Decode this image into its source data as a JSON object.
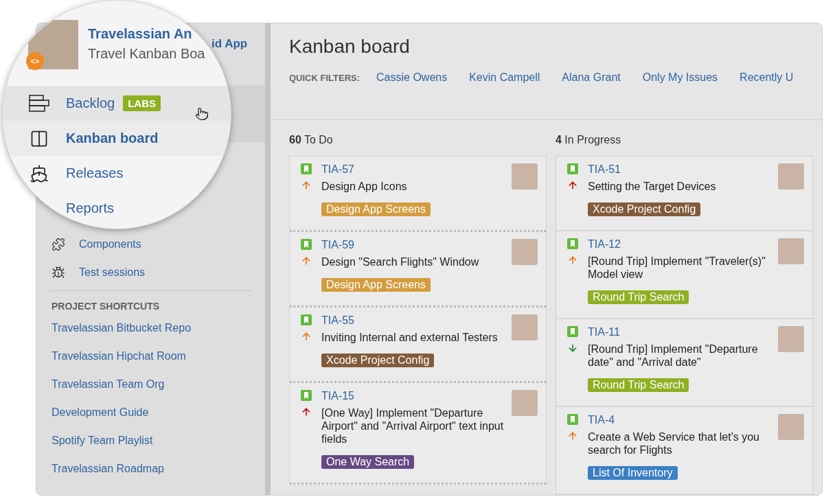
{
  "sidebar": {
    "project_title_tail": "id App",
    "items": [
      {
        "label": "Components"
      },
      {
        "label": "Test sessions"
      }
    ],
    "shortcuts_heading": "PROJECT SHORTCUTS",
    "shortcuts": [
      "Travelassian Bitbucket Repo",
      "Travelassian Hipchat Room",
      "Travelassian Team Org",
      "Development Guide",
      "Spotify Team Playlist",
      "Travelassian Roadmap"
    ]
  },
  "magnifier": {
    "project_title": "Travelassian An",
    "board_name": "Travel Kanban Boa",
    "badge": "<>",
    "items": [
      {
        "label": "Backlog",
        "badge": "LABS",
        "selected": false,
        "hovered": true
      },
      {
        "label": "Kanban board",
        "selected": true,
        "hovered": false
      },
      {
        "label": "Releases",
        "selected": false,
        "hovered": false
      },
      {
        "label": "Reports",
        "selected": false,
        "hovered": false
      }
    ]
  },
  "board": {
    "title": "Kanban board",
    "quick_filters_label": "QUICK FILTERS:",
    "quick_filters": [
      "Cassie Owens",
      "Kevin Campell",
      "Alana Grant",
      "Only My Issues",
      "Recently U"
    ],
    "columns": [
      {
        "count": "60",
        "name": "To Do",
        "ranked": true,
        "cards": [
          {
            "key": "TIA-57",
            "kind": "high",
            "summary": "Design App Icons",
            "epic": "Design App Screens",
            "color": "#d39c3f"
          },
          {
            "key": "TIA-59",
            "kind": "high",
            "summary": "Design \"Search Flights\" Window",
            "epic": "Design App Screens",
            "color": "#d39c3f"
          },
          {
            "key": "TIA-55",
            "kind": "high",
            "summary": "Inviting Internal and external Testers",
            "epic": "Xcode Project Config",
            "color": "#815b3a"
          },
          {
            "key": "TIA-15",
            "kind": "highest",
            "summary": "[One Way] Implement \"Departure Airport\" and \"Arrival Airport\" text input fields",
            "epic": "One Way Search",
            "color": "#654982"
          }
        ]
      },
      {
        "count": "4",
        "name": "In Progress",
        "ranked": false,
        "cards": [
          {
            "key": "TIA-51",
            "kind": "highest",
            "summary": "Setting the Target Devices",
            "epic": "Xcode Project Config",
            "color": "#815b3a"
          },
          {
            "key": "TIA-12",
            "kind": "high",
            "summary": "[Round Trip] Implement \"Traveler(s)\" Model view",
            "epic": "Round Trip Search",
            "color": "#8eb021"
          },
          {
            "key": "TIA-11",
            "kind": "low",
            "summary": "[Round Trip] Implement \"Departure date\" and \"Arrival date\"",
            "epic": "Round Trip Search",
            "color": "#8eb021"
          },
          {
            "key": "TIA-4",
            "kind": "high",
            "summary": "Create a Web Service that let's you search for Flights",
            "epic": "List Of Inventory",
            "color": "#3b7fc4"
          }
        ]
      }
    ]
  }
}
